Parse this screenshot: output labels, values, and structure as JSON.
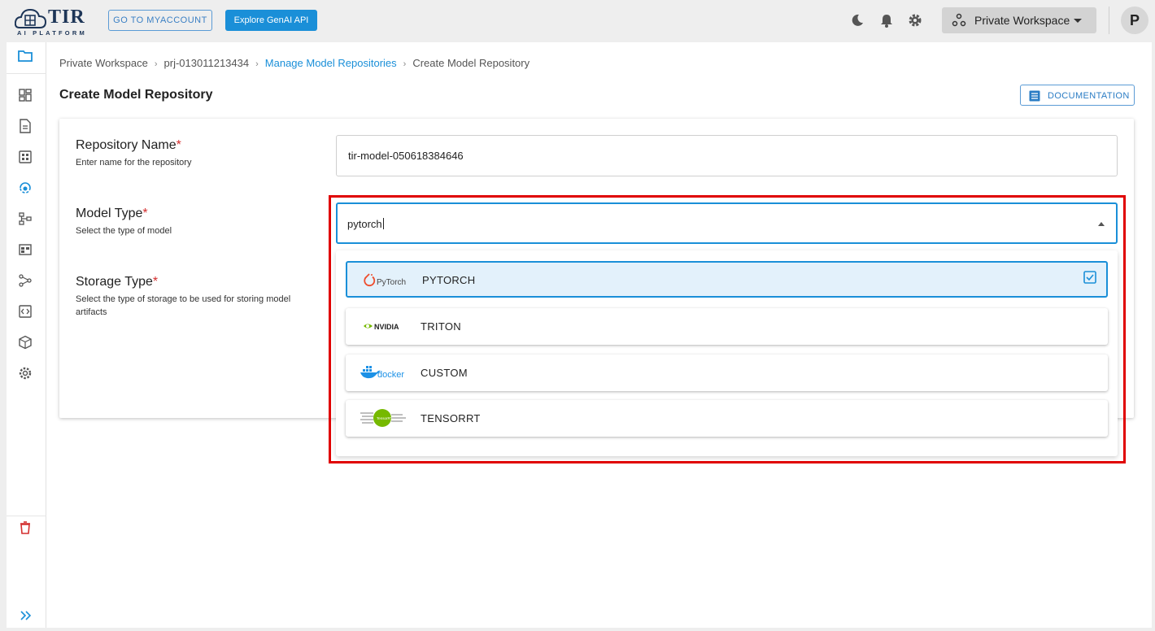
{
  "header": {
    "logo_text": "TIR",
    "logo_sub": "AI PLATFORM",
    "myaccount_label": "GO TO MYACCOUNT",
    "genai_label": "Explore GenAI API",
    "workspace_label": "Private Workspace",
    "avatar_initial": "P",
    "icons": [
      "moon-icon",
      "bell-icon",
      "gear-icon"
    ]
  },
  "sidebar": {
    "items": [
      "folder-icon",
      "dashboard-icon",
      "notebook-icon",
      "grid-icon",
      "model-repo-icon",
      "pipeline-icon",
      "dataset-icon",
      "share-icon",
      "code-icon",
      "cube-icon",
      "settings-icon"
    ],
    "bottom": [
      "trash-icon",
      "expand-icon"
    ]
  },
  "breadcrumb": {
    "items": [
      "Private Workspace",
      "prj-013011213434",
      "Manage Model Repositories",
      "Create Model Repository"
    ]
  },
  "page": {
    "title": "Create Model Repository",
    "docs_label": "DOCUMENTATION"
  },
  "form": {
    "repo_name": {
      "label": "Repository Name",
      "required": "*",
      "help": "Enter name for the repository",
      "value": "tir-model-050618384646"
    },
    "model_type": {
      "label": "Model Type",
      "required": "*",
      "help": "Select the type of model",
      "value": "pytorch"
    },
    "storage_type": {
      "label": "Storage Type",
      "required": "*",
      "help": "Select the type of storage to be used for storing model artifacts"
    }
  },
  "dropdown": {
    "options": [
      {
        "label": "PYTORCH",
        "logo": "PyTorch",
        "selected": true
      },
      {
        "label": "TRITON",
        "logo": "NVIDIA",
        "selected": false
      },
      {
        "label": "CUSTOM",
        "logo": "docker",
        "selected": false
      },
      {
        "label": "TENSORRT",
        "logo": "TensorRT",
        "selected": false
      }
    ]
  },
  "colors": {
    "accent": "#1a8fd8",
    "highlight": "#e00000",
    "required": "#d32f2f",
    "selected_bg": "#e3f1fb"
  }
}
